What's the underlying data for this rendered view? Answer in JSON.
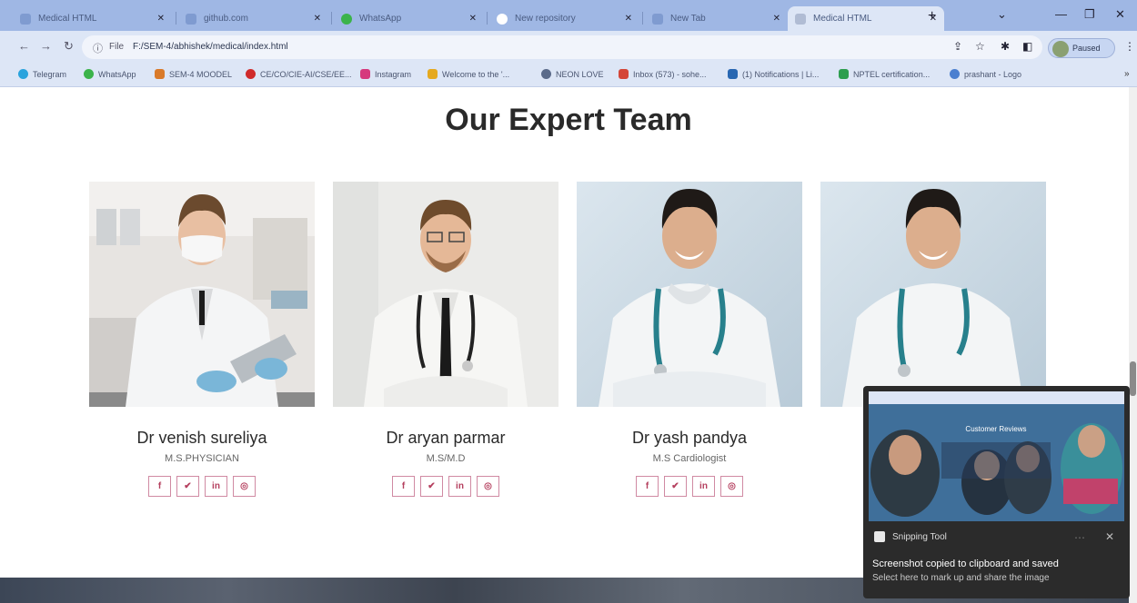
{
  "browser": {
    "tabs": [
      {
        "title": "Medical HTML",
        "active": false
      },
      {
        "title": "github.com",
        "active": false
      },
      {
        "title": "WhatsApp",
        "active": false
      },
      {
        "title": "New repository",
        "active": false
      },
      {
        "title": "New Tab",
        "active": false
      },
      {
        "title": "Medical HTML",
        "active": true
      }
    ],
    "new_tab_label": "+",
    "url_label": "File",
    "url": "F:/SEM-4/abhishek/medical/index.html",
    "profile_name": "Paused",
    "bookmarks": [
      "Telegram",
      "WhatsApp",
      "SEM-4 MOODEL",
      "CE/CO/CIE-AI/CSE/EE...",
      "Instagram",
      "Welcome to the '...",
      "NEON LOVE",
      "Inbox (573) - sohe...",
      "(1) Notifications | Li...",
      "NPTEL certification...",
      "prashant - Logo"
    ]
  },
  "page": {
    "section_title": "Our Expert Team",
    "doctors": [
      {
        "name": "Dr venish sureliya",
        "role": "M.S.PHYSICIAN"
      },
      {
        "name": "Dr aryan parmar",
        "role": "M.S/M.D"
      },
      {
        "name": "Dr yash pandya",
        "role": "M.S Cardiologist"
      },
      {
        "name": "",
        "role": ""
      }
    ],
    "social_icons": [
      "f",
      "✔",
      "in",
      "◎"
    ]
  },
  "toast": {
    "app_name": "Snipping Tool",
    "message": "Screenshot copied to clipboard and saved",
    "sub_message": "Select here to mark up and share the image",
    "preview_heading": "Customer Reviews"
  },
  "colors": {
    "accent": "#b5405f",
    "tabstrip": "#9fb7e4",
    "toolbar": "#dde6f6"
  }
}
